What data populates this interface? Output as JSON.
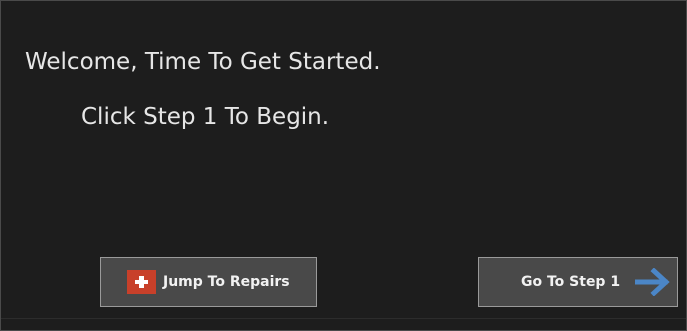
{
  "welcome_text": "Welcome, Time To Get Started.",
  "instruction_text": "Click Step 1 To Begin.",
  "buttons": {
    "jump_to_repairs": "Jump To Repairs",
    "go_to_step_1": "Go To Step 1"
  },
  "icons": {
    "repairs": "plus-icon",
    "step": "arrow-right-icon"
  },
  "colors": {
    "background": "#1d1d1d",
    "button_background": "#494949",
    "button_border": "#9a9a9a",
    "plus_badge": "#c8402a",
    "arrow": "#4b86c7",
    "text": "#e6e6e6"
  }
}
